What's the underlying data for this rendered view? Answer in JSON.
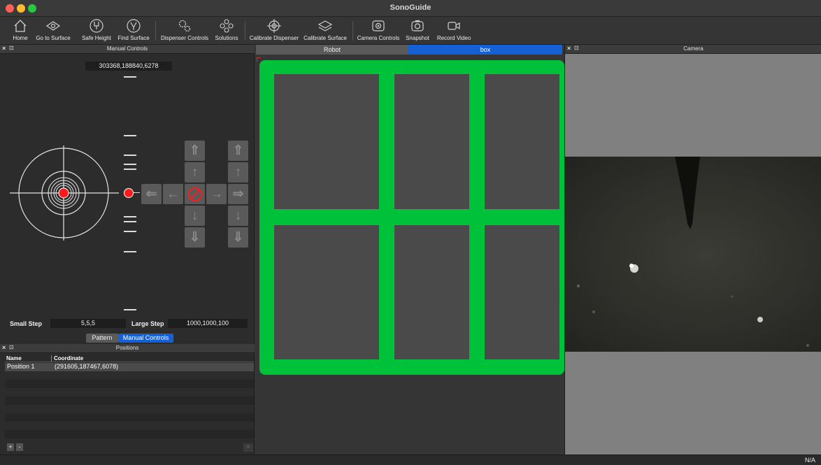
{
  "window": {
    "title": "SonoGuide"
  },
  "toolbar": {
    "items": [
      {
        "label": "Home",
        "icon": "home-icon"
      },
      {
        "label": "Go to Surface",
        "icon": "go-to-surface-icon"
      },
      {
        "label": "Safe Height",
        "icon": "safe-height-icon"
      },
      {
        "label": "Find Surface",
        "icon": "find-surface-icon"
      },
      {
        "label": "Dispenser Controls",
        "icon": "gears-icon"
      },
      {
        "label": "Solutions",
        "icon": "solutions-icon"
      },
      {
        "label": "Calibrate Dispenser",
        "icon": "crosshair-icon"
      },
      {
        "label": "Calibrate Surface",
        "icon": "layers-icon"
      },
      {
        "label": "Camera Controls",
        "icon": "camera-icon"
      },
      {
        "label": "Snapshot",
        "icon": "snapshot-icon"
      },
      {
        "label": "Record Video",
        "icon": "video-icon"
      }
    ]
  },
  "manual_controls": {
    "title": "Manual Controls",
    "coordinate": "303368,188840,6278",
    "small_step_label": "Small Step",
    "small_step_value": "5,5,5",
    "large_step_label": "Large Step",
    "large_step_value": "1000,1000,100",
    "tabs": [
      "Pattern",
      "Manual Controls"
    ],
    "active_tab": "Manual Controls"
  },
  "positions": {
    "title": "Positions",
    "columns": [
      "Name",
      "Coordinate"
    ],
    "rows": [
      {
        "name": "Position 1",
        "coordinate": "(291605,187467,6078)"
      }
    ],
    "add_label": "+",
    "remove_label": "-"
  },
  "center": {
    "tabs": [
      "Robot",
      "box"
    ],
    "active_tab": "box",
    "grid_color": "#00c23a"
  },
  "camera": {
    "title": "Camera"
  },
  "status": {
    "text": "N/A"
  },
  "colors": {
    "accent": "#1560d4",
    "target": "#ff1a1a"
  }
}
